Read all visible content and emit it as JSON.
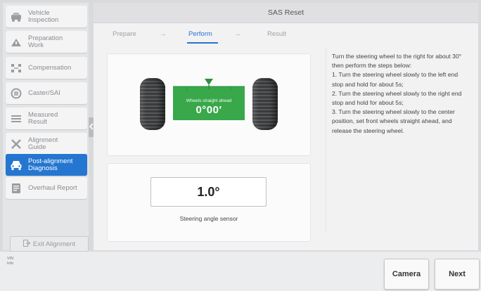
{
  "sidebar": {
    "items": [
      {
        "label": "Vehicle\nInspection",
        "icon": "vehicle-inspection-icon",
        "active": false
      },
      {
        "label": "Preparation\nWork",
        "icon": "preparation-icon",
        "active": false
      },
      {
        "label": "Compensation",
        "icon": "compensation-icon",
        "active": false
      },
      {
        "label": "Caster/SAI",
        "icon": "caster-icon",
        "active": false
      },
      {
        "label": "Measured\nResult",
        "icon": "measured-result-icon",
        "active": false
      },
      {
        "label": "Alignment\nGuide",
        "icon": "alignment-guide-icon",
        "active": false
      },
      {
        "label": "Post-alignment\nDiagnosis",
        "icon": "car-icon",
        "active": true
      },
      {
        "label": "Overhaul Report",
        "icon": "report-icon",
        "active": false
      }
    ],
    "exit_label": "Exit Alignment"
  },
  "header": {
    "title": "SAS Reset"
  },
  "steps": {
    "items": [
      "Prepare",
      "Perform",
      "Result"
    ],
    "arrow": "→",
    "active_index": 1
  },
  "wheel_panel": {
    "label": "Wheels straight ahead",
    "value": "0°00'"
  },
  "sensor_panel": {
    "value": "1.0°",
    "label": "Steering angle sensor"
  },
  "instructions": "Turn the steering wheel to the right for about 30° then perform the steps below:\n1. Turn the steering wheel slowly to the left end stop and hold for about 5s;\n2. Turn the steering wheel slowly to the right end stop and hold for about 5s;\n3. Turn the steering wheel slowly to the center position, set front wheels straight ahead, and release the steering wheel.",
  "footer": {
    "vin_info": "VIN\nInfo",
    "camera_label": "Camera",
    "next_label": "Next"
  },
  "colors": {
    "accent": "#2476d0",
    "green": "#38a84a"
  }
}
